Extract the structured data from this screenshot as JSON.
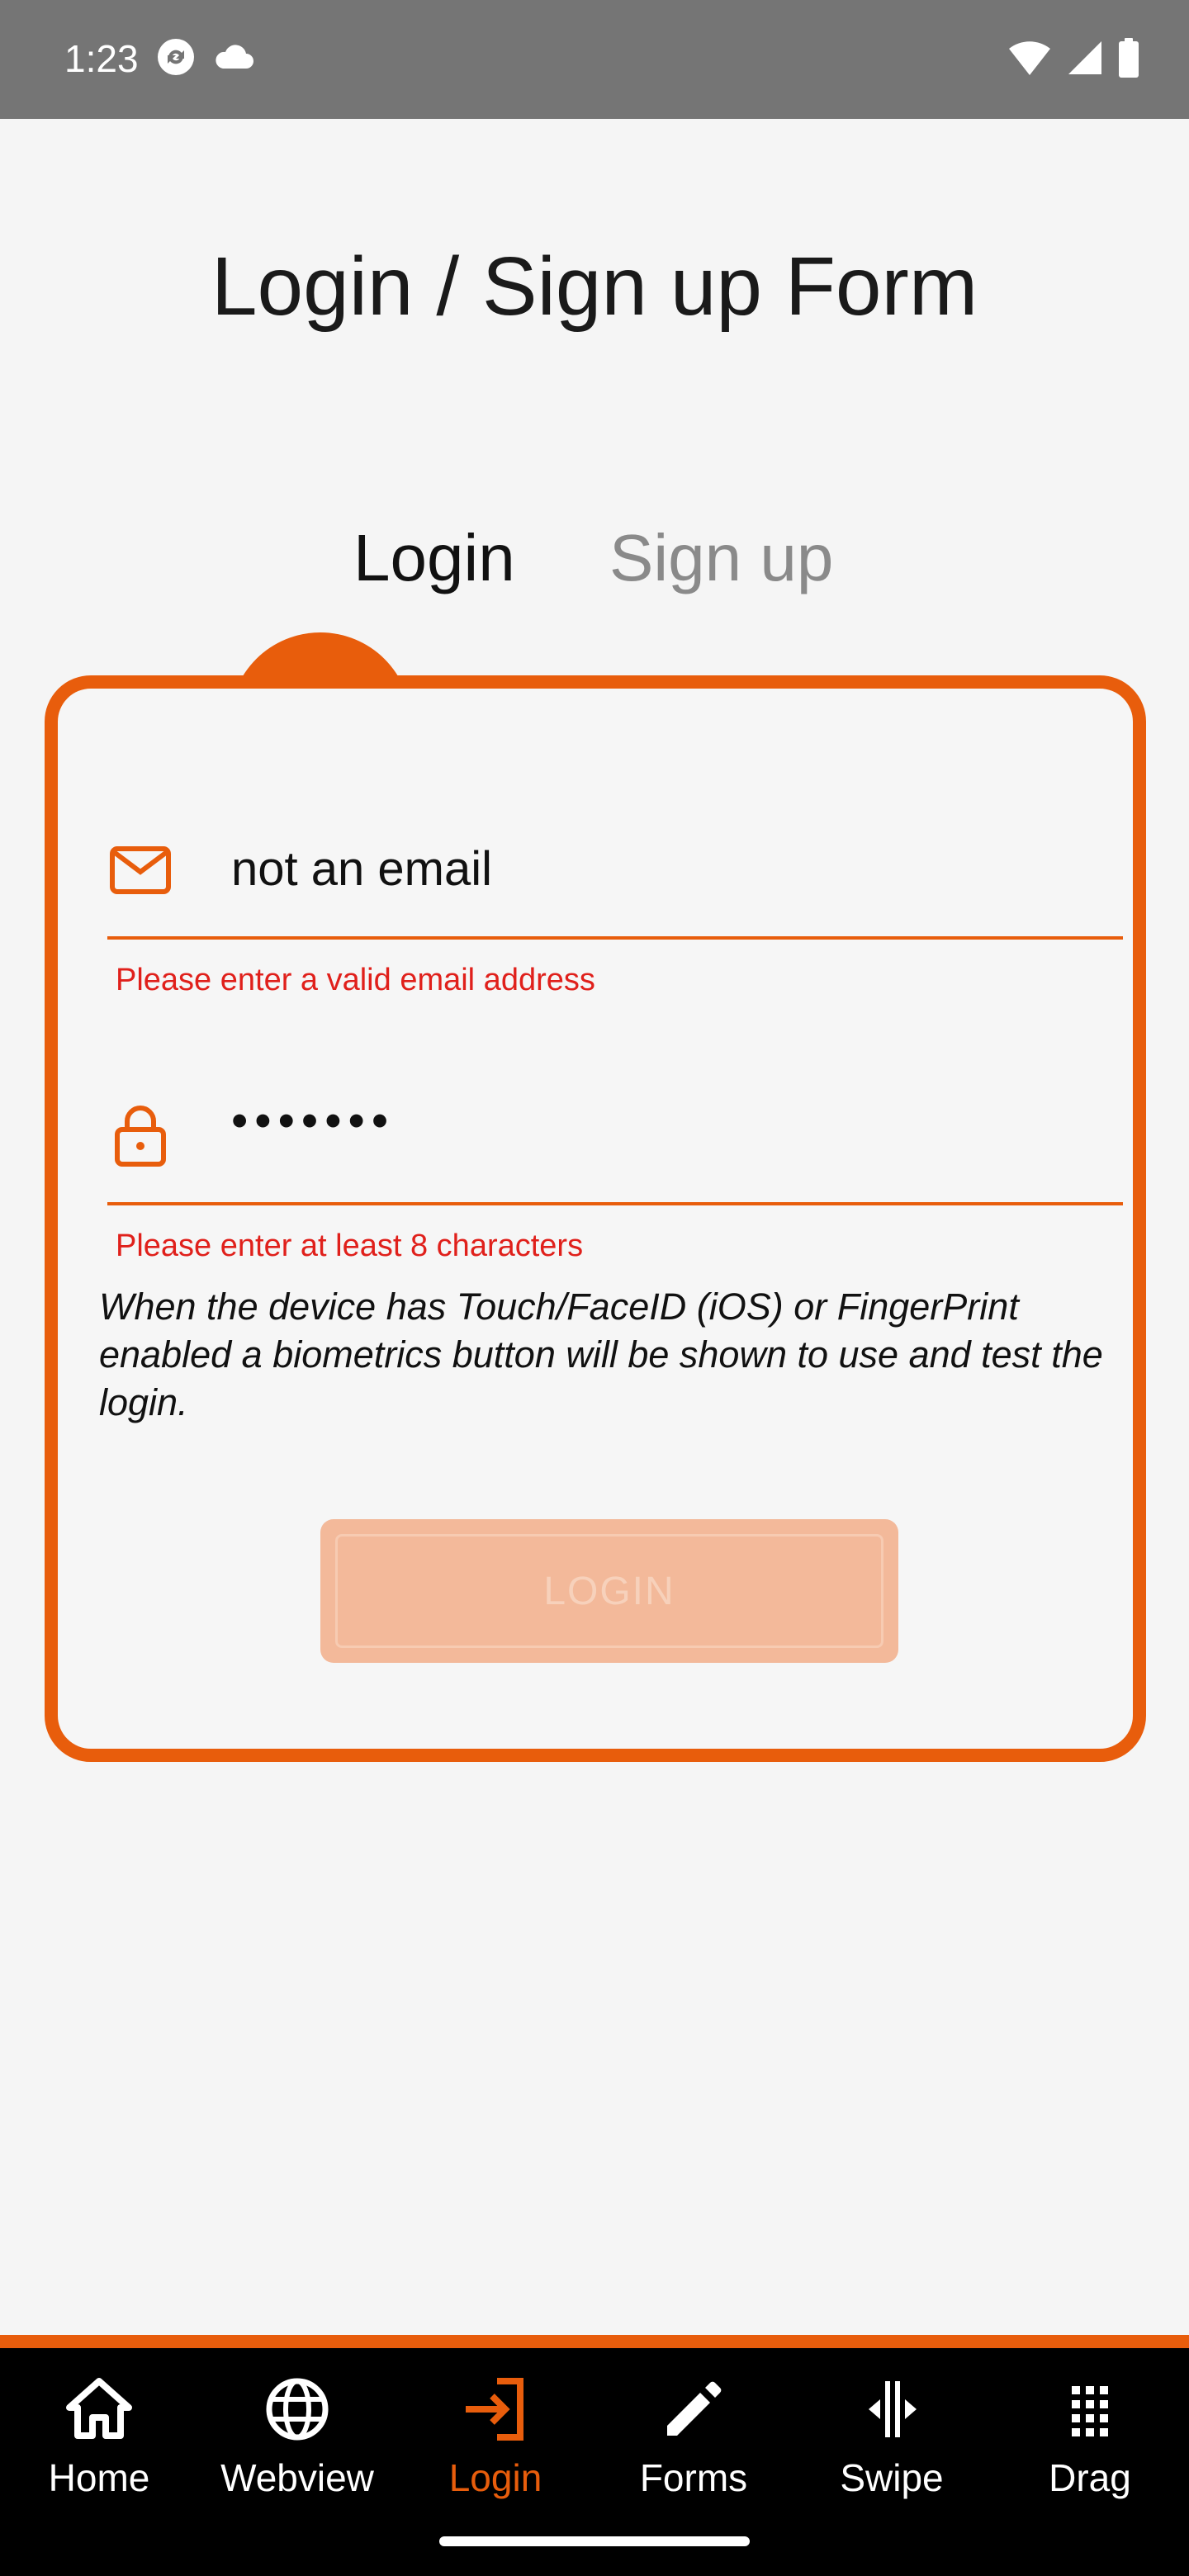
{
  "status_bar": {
    "time": "1:23",
    "icons": [
      "sync-icon",
      "cloud-icon",
      "wifi-icon",
      "signal-icon",
      "battery-icon"
    ]
  },
  "page": {
    "title": "Login / Sign up Form"
  },
  "tabs": [
    {
      "label": "Login",
      "active": true
    },
    {
      "label": "Sign up",
      "active": false
    }
  ],
  "form": {
    "email": {
      "value": "not an email",
      "icon": "mail-icon",
      "error": "Please enter a valid email address"
    },
    "password": {
      "value": "•••••••",
      "icon": "lock-icon",
      "error": "Please enter at least 8 characters"
    },
    "hint": "When the device has Touch/FaceID (iOS) or FingerPrint enabled a biometrics button will be shown to use and test the login.",
    "login_button": "LOGIN"
  },
  "nav": {
    "items": [
      {
        "label": "Home",
        "icon": "home-icon",
        "active": false
      },
      {
        "label": "Webview",
        "icon": "globe-icon",
        "active": false
      },
      {
        "label": "Login",
        "icon": "login-icon",
        "active": true
      },
      {
        "label": "Forms",
        "icon": "pencil-icon",
        "active": false
      },
      {
        "label": "Swipe",
        "icon": "swipe-icon",
        "active": false
      },
      {
        "label": "Drag",
        "icon": "drag-grid-icon",
        "active": false
      }
    ]
  },
  "colors": {
    "accent": "#e85d0c",
    "error": "#e0201b",
    "nav_background": "#000000",
    "status_bar": "#757575",
    "background": "#f5f5f5"
  }
}
